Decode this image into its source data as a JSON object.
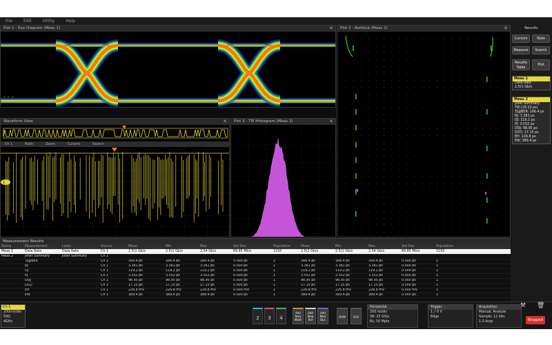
{
  "menu": [
    "File",
    "Edit",
    "Utility",
    "Help"
  ],
  "panels": {
    "eye": {
      "title": "Plot 1 - Eye Diagram (Meas 1)"
    },
    "waveform": {
      "title": "Waveform View"
    },
    "waveform_toolbar": [
      "Ch 1",
      "Math",
      "Zoom",
      "Cursors",
      "Search"
    ],
    "histogram": {
      "title": "Plot 3 - TIE Histogram (Meas 2)"
    },
    "bathtub": {
      "title": "Plot 2 - Bathtub (Meas 2)"
    },
    "results": {
      "title": "Measurement Results"
    }
  },
  "right_panel": {
    "title": "Results",
    "buttons": {
      "cursors": "Cursors",
      "note": "Note",
      "measure": "Measure",
      "search": "Search",
      "results_table": "Results Table",
      "plot": "Plot"
    },
    "meas1": {
      "header": "Meas 1",
      "lines": [
        "Data Rate",
        "2.5(1 Gb/s"
      ]
    },
    "meas2": {
      "header": "Meas 2",
      "lines": [
        "Jitter Summary",
        "TIE:(29.23 ps)",
        "TJ@BER: 166.4 ps",
        "RJ: 3.361 ps",
        "DJ: 119.2 ps",
        "PJ: 3.552 ps",
        "DDJ: 98.95 ps",
        "DCD: 17.15 ps",
        "EH: 226.8 ps",
        "EW: 389.4 ps"
      ]
    }
  },
  "results_table": {
    "headers": [
      "Name",
      "Measurement",
      "Label",
      "Source",
      "Mean",
      "Min",
      "Max",
      "Std Dev",
      "Population",
      "Mean",
      "Min",
      "Max",
      "Std Dev",
      "Population"
    ],
    "rows": [
      [
        "Meas 1",
        "Data Rate",
        "Data Rate",
        "Ch 1",
        "2.5(1 Gb/s",
        "2.5(1 Gb/s",
        "2.54 Gb/s",
        "89.85 Mb/s",
        "1193",
        "2.5(2 Gb/s",
        "2.5(1 Gb/s",
        "2.54 Gb/s",
        "89.85 Mb/s",
        "1193"
      ],
      [
        "Meas 2",
        "Jitter Summary",
        "Jitter Summary",
        "Ch 1",
        "",
        "",
        "",
        "",
        "",
        "",
        "",
        "",
        "",
        ""
      ],
      [
        "",
        "TJ@BER",
        "",
        "Ch 1",
        "166.4 ps",
        "166.4 ps",
        "166.4 ps",
        "0.000 ps",
        "1",
        "166.4 ps",
        "166.4 ps",
        "166.4 ps",
        "0.000 ps",
        "1"
      ],
      [
        "",
        "RJ",
        "",
        "Ch 1",
        "3.361 ps",
        "3.361 ps",
        "3.361 ps",
        "0.000 ps",
        "1",
        "3.361 ps",
        "3.361 ps",
        "3.361 ps",
        "0.000 ps",
        "1"
      ],
      [
        "",
        "DJ",
        "",
        "Ch 1",
        "119.2 ps",
        "119.2 ps",
        "119.2 ps",
        "0.000 ps",
        "1",
        "119.2 ps",
        "119.2 ps",
        "119.2 ps",
        "0.000 ps",
        "1"
      ],
      [
        "",
        "PJ",
        "",
        "Ch 1",
        "3.552 ps",
        "3.552 ps",
        "3.552 ps",
        "0.000 ps",
        "1",
        "3.552 ps",
        "3.552 ps",
        "3.552 ps",
        "0.000 ps",
        "1"
      ],
      [
        "",
        "DDJ",
        "",
        "Ch 1",
        "98.95 ps",
        "98.95 ps",
        "98.95 ps",
        "0.000 ps",
        "1",
        "98.95 ps",
        "98.95 ps",
        "98.95 ps",
        "0.000 ps",
        "1"
      ],
      [
        "",
        "DCD",
        "",
        "Ch 1",
        "17.15 ps",
        "17.15 ps",
        "17.15 ps",
        "0.000 ps",
        "1",
        "17.15 ps",
        "17.15 ps",
        "17.15 ps",
        "0.000 ps",
        "1"
      ],
      [
        "",
        "EH",
        "",
        "Ch 1",
        "226.8 mV",
        "226.8 mV",
        "226.8 mV",
        "0.000 mV",
        "1",
        "226.8 mV",
        "226.8 mV",
        "226.8 mV",
        "0.000 mV",
        "1"
      ],
      [
        "",
        "EW",
        "",
        "Ch 1",
        "389.4 ps",
        "389.4 ps",
        "389.4 ps",
        "0.000 ps",
        "1",
        "389.4 ps",
        "389.4 ps",
        "389.4 ps",
        "0.000 ps",
        "1"
      ]
    ]
  },
  "bottom": {
    "ch1": {
      "header": "Ch 1",
      "lines": [
        "200mV/div",
        "50Ω",
        "4GHz"
      ]
    },
    "channels": [
      "2",
      "3",
      "4"
    ],
    "new_buttons": [
      "Add New Math",
      "Add New Ref",
      "Add New Bus"
    ],
    "extra_buttons": [
      "DVM",
      "AFG"
    ],
    "horizontal": {
      "header": "Horizontal",
      "lines": [
        "200 ns/div",
        "SR: 25 GS/s",
        "RL: 50 Mpts"
      ]
    },
    "trigger": {
      "header": "Trigger",
      "lines": [
        "1  ╱  0 V",
        "Edge"
      ]
    },
    "acquisition": {
      "header": "Acquisition",
      "lines": [
        "Manual, Analyze",
        "Sample: 12 bits",
        "1.0 Acqs"
      ]
    },
    "stop": "Stopped"
  },
  "colors": {
    "ch1": "#e6d73a",
    "histogram": "#c455d8",
    "bathtub": "#2ecf3a",
    "stop": "#d9302c"
  }
}
